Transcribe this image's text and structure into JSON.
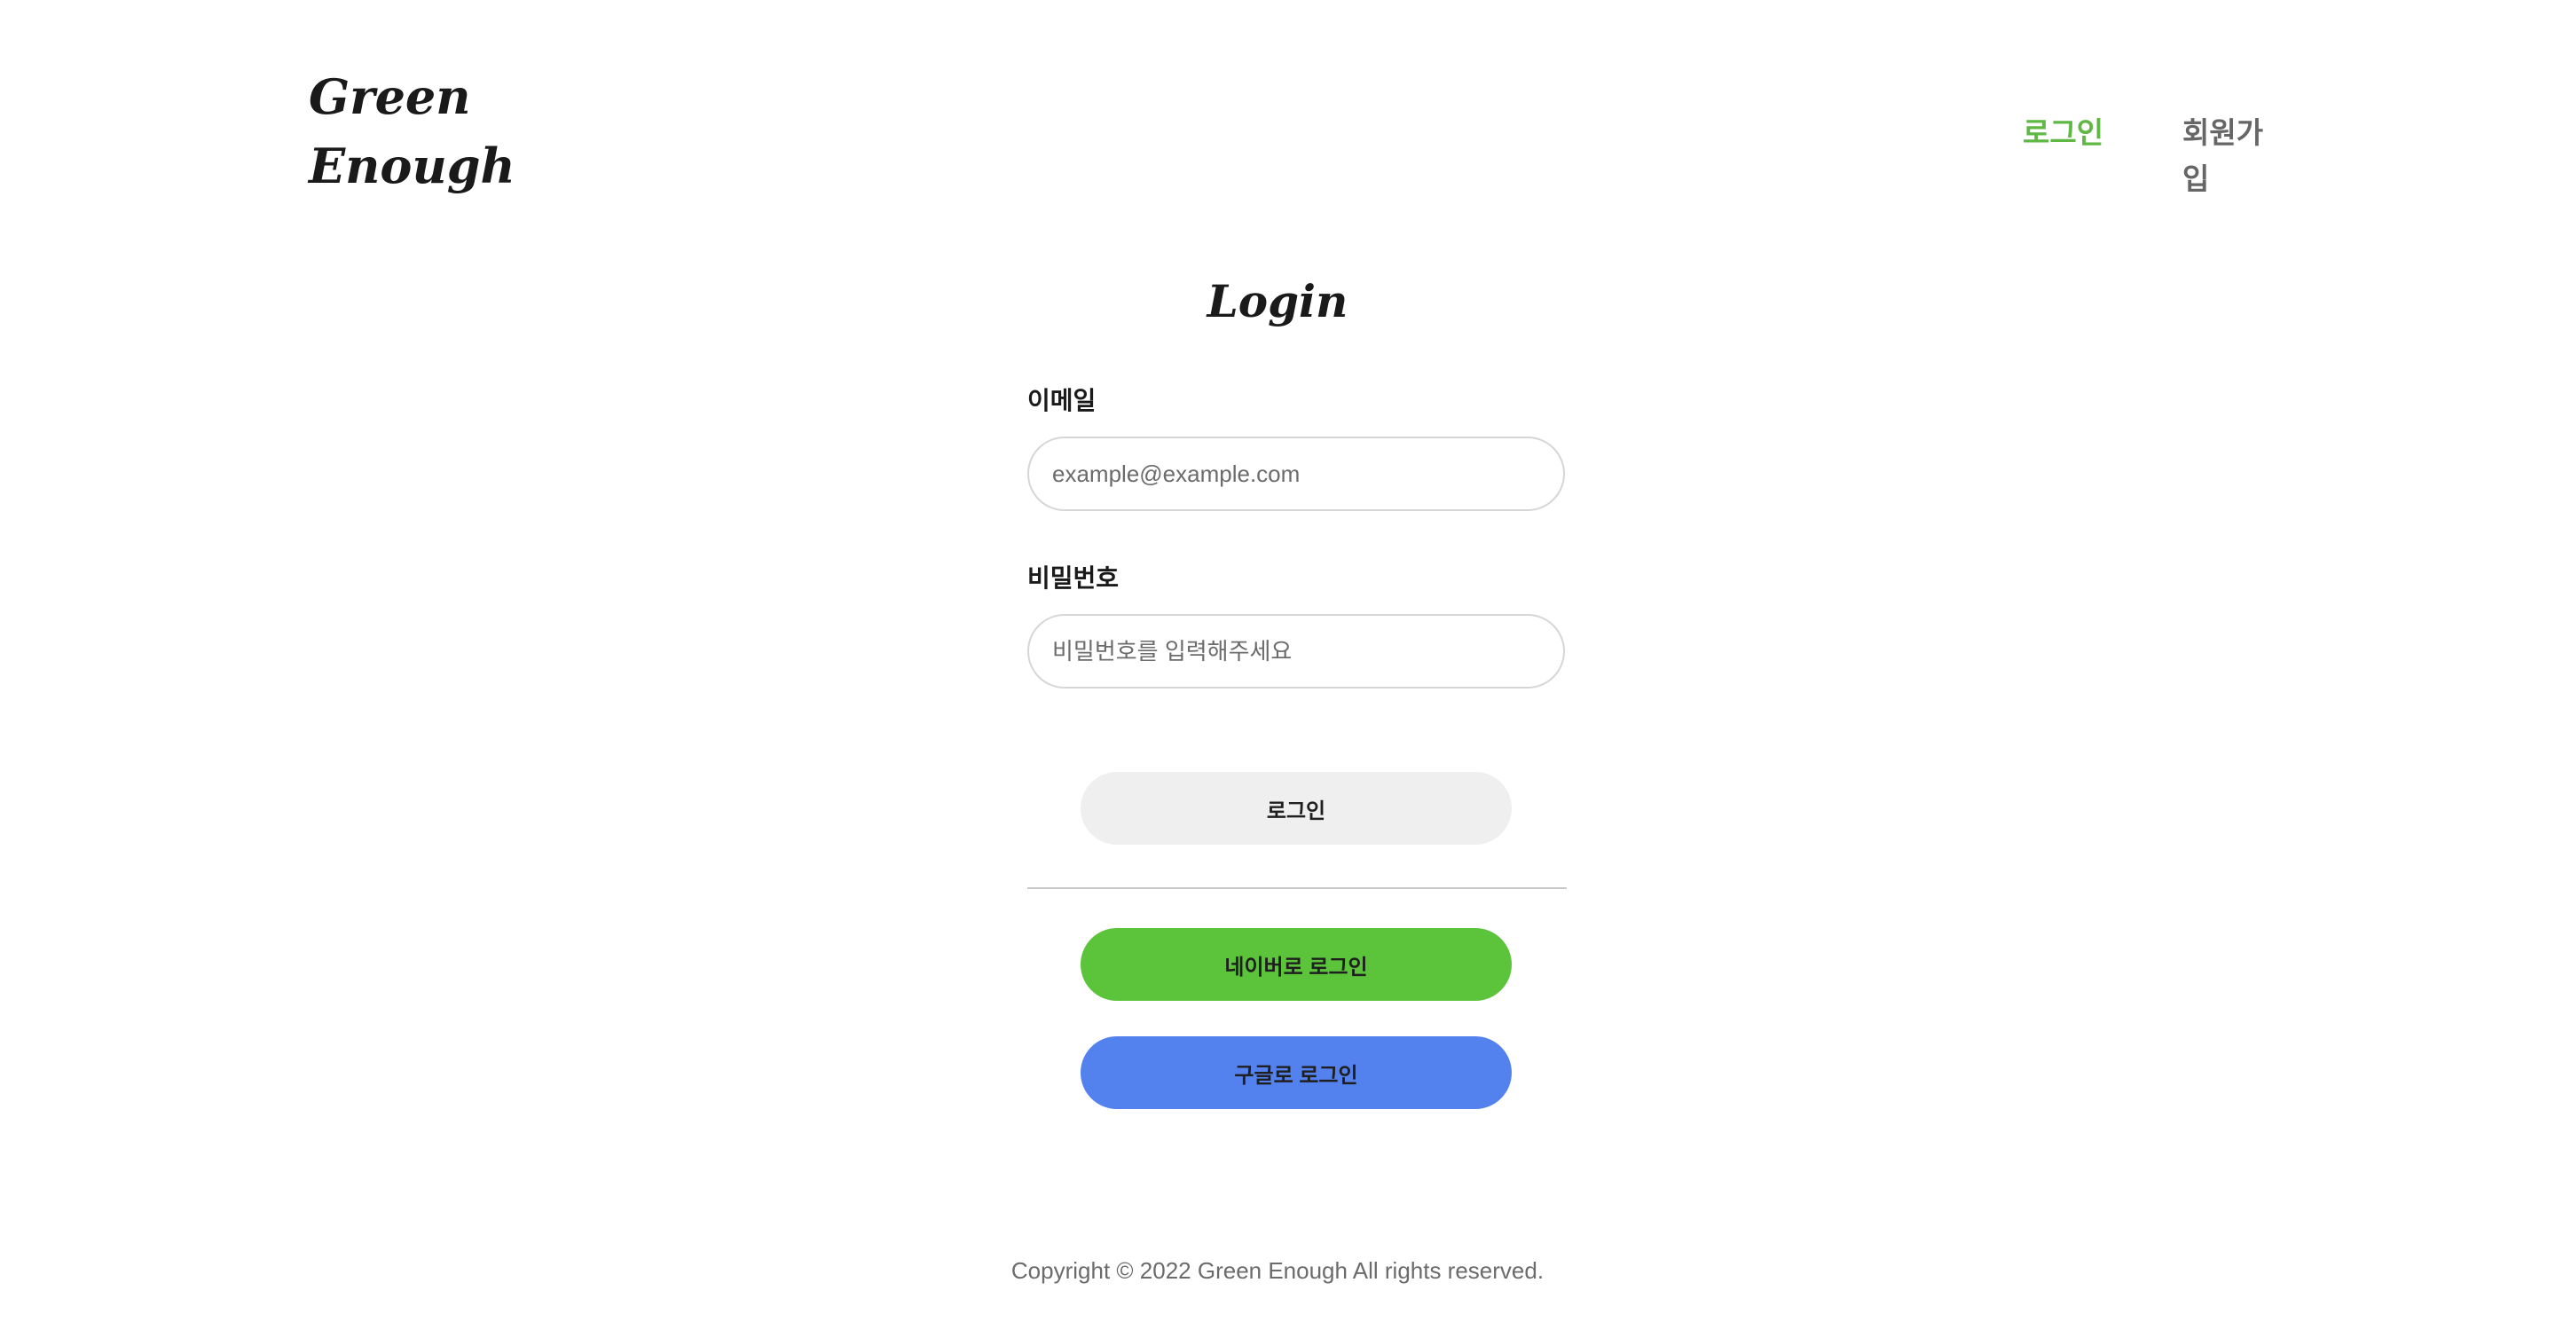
{
  "header": {
    "logo_line1": "Green",
    "logo_line2": "Enough",
    "nav": {
      "login": "로그인",
      "signup": "회원가입"
    }
  },
  "main": {
    "title": "Login",
    "email": {
      "label": "이메일",
      "placeholder": "example@example.com",
      "value": ""
    },
    "password": {
      "label": "비밀번호",
      "placeholder": "비밀번호를 입력해주세요",
      "value": ""
    },
    "login_button": "로그인",
    "naver_button": "네이버로 로그인",
    "google_button": "구글로 로그인"
  },
  "footer": {
    "copyright": "Copyright © 2022 Green Enough All rights reserved."
  },
  "colors": {
    "accent_green": "#5fb843",
    "nav_inactive": "#666666",
    "login_button_bg": "#efefef",
    "naver_bg": "#5bc43b",
    "google_bg": "#5382ee"
  }
}
